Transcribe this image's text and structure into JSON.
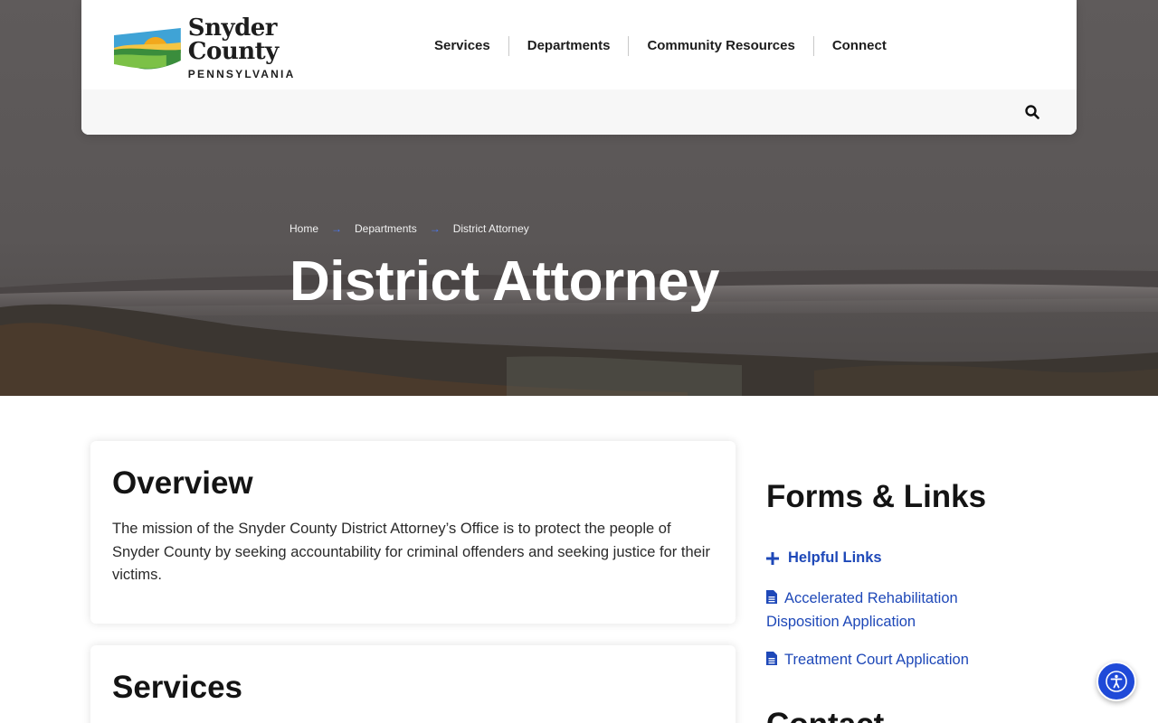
{
  "brand": {
    "name": "Snyder County",
    "state": "PENNSYLVANIA"
  },
  "nav": {
    "items": [
      {
        "label": "Services"
      },
      {
        "label": "Departments"
      },
      {
        "label": "Community Resources"
      },
      {
        "label": "Connect"
      }
    ],
    "search_icon": "search-icon"
  },
  "breadcrumb": {
    "home": "Home",
    "departments": "Departments",
    "current": "District Attorney",
    "separator": "→"
  },
  "page": {
    "title": "District Attorney"
  },
  "overview": {
    "heading": "Overview",
    "text": "The mission of the Snyder County District Attorney’s Office is to protect the people of Snyder County by seeking accountability for criminal offenders and seeking justice for their victims."
  },
  "services": {
    "heading": "Services"
  },
  "sidebar": {
    "heading": "Forms & Links",
    "helpful_links": "Helpful Links",
    "links": [
      {
        "label": "Accelerated Rehabilitation Disposition Application",
        "icon": "file-icon"
      },
      {
        "label": "Treatment Court Application",
        "icon": "file-icon"
      }
    ],
    "contact_heading": "Contact"
  },
  "colors": {
    "link_blue": "#1e48b8",
    "breadcrumb_arrow": "#4a79ff",
    "accessibility_button": "#1f4ad8"
  },
  "accessibility": {
    "icon": "accessibility-icon"
  }
}
